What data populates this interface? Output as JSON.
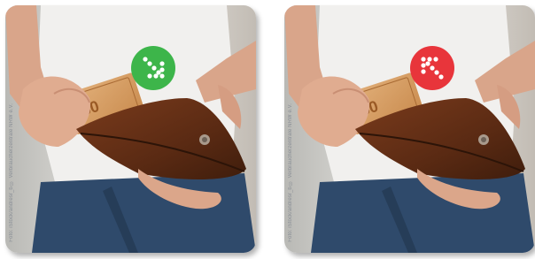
{
  "panels": [
    {
      "credit": "Foto: iStock/andresr_b © Verbraucherzentrale NRW e.V.",
      "badge_icon": "arrow-down-right-dotted-icon",
      "badge_color": "#3db54a"
    },
    {
      "credit": "Foto: iStock/andresr_b © Verbraucherzentrale NRW e.V.",
      "badge_icon": "arrow-up-left-dotted-icon",
      "badge_color": "#e8353b"
    }
  ]
}
